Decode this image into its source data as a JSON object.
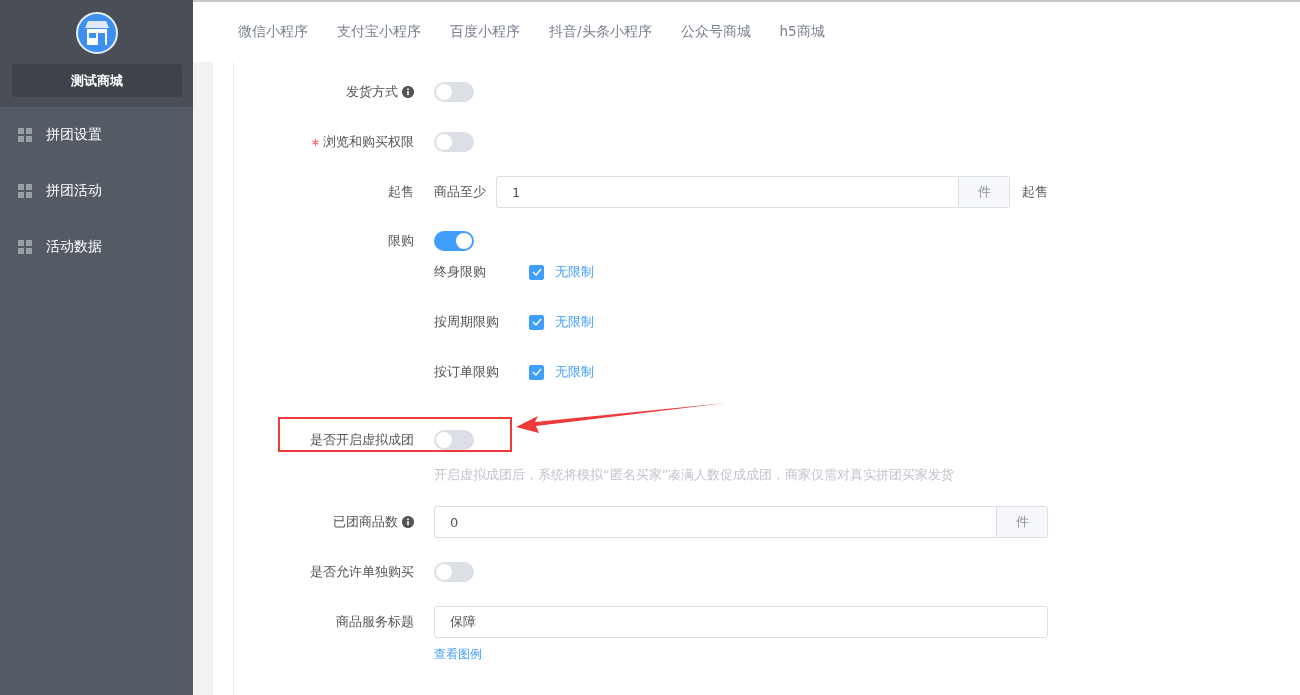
{
  "sidebar": {
    "shop_name": "测试商城",
    "items": [
      {
        "label": "拼团设置",
        "selected": false
      },
      {
        "label": "拼团活动",
        "selected": false
      },
      {
        "label": "活动数据",
        "selected": false
      }
    ]
  },
  "tabs": [
    {
      "label": "微信小程序",
      "selected": false
    },
    {
      "label": "支付宝小程序",
      "selected": false
    },
    {
      "label": "百度小程序",
      "selected": false
    },
    {
      "label": "抖音/头条小程序",
      "selected": false
    },
    {
      "label": "公众号商城",
      "selected": false
    },
    {
      "label": "h5商城",
      "selected": false
    }
  ],
  "form": {
    "fields": [
      {
        "kind": "switch",
        "label": "发货方式",
        "info": true,
        "on": false
      },
      {
        "kind": "switch",
        "label": "浏览和购买权限",
        "required": true,
        "on": false
      },
      {
        "kind": "addon-input",
        "label": "起售",
        "prefix": "商品至少",
        "value": "1",
        "addon": "件",
        "suffix": "起售"
      },
      {
        "kind": "limits",
        "label": "限购",
        "on": true,
        "limits": [
          {
            "label": "终身限购",
            "checked": true,
            "option": "无限制"
          },
          {
            "label": "按周期限购",
            "checked": true,
            "option": "无限制"
          },
          {
            "label": "按订单限购",
            "checked": true,
            "option": "无限制"
          }
        ]
      },
      {
        "kind": "switch",
        "label": "是否开启虚拟成团",
        "on": false,
        "highlighted": true,
        "hint": "开启虚拟成团后，系统将模拟“匿名买家”凑满人数促成成团，商家仅需对真实拼团买家发货"
      },
      {
        "kind": "addon-input",
        "label": "已团商品数",
        "info": true,
        "value": "0",
        "addon": "件"
      },
      {
        "kind": "switch",
        "label": "是否允许单独购买",
        "on": false
      },
      {
        "kind": "input",
        "label": "商品服务标题",
        "value": "保障",
        "link": "查看图例"
      }
    ]
  }
}
